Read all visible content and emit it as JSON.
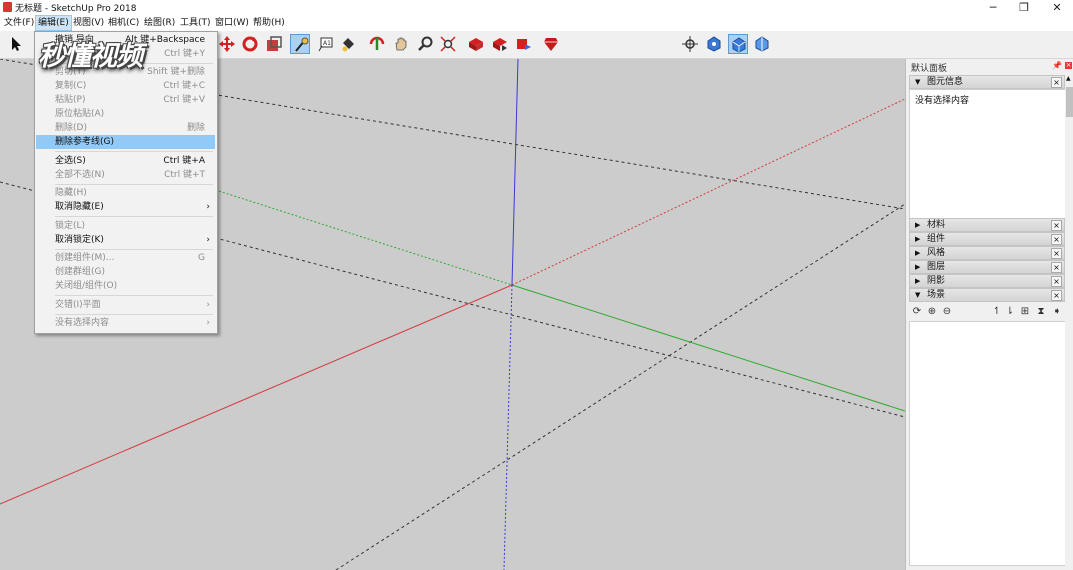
{
  "window": {
    "title": "无标题 - SketchUp Pro 2018",
    "controls": [
      "minimize-icon",
      "restore-icon",
      "close-icon"
    ]
  },
  "menubar": [
    "文件(F)",
    "编辑(E)",
    "视图(V)",
    "相机(C)",
    "绘图(R)",
    "工具(T)",
    "窗口(W)",
    "帮助(H)"
  ],
  "watermark": "秒懂视频",
  "edit_menu": [
    {
      "label": "撤销 导向",
      "shortcut": "Alt 键+Backspace",
      "disabled": false
    },
    {
      "label": "重复",
      "shortcut": "Ctrl 键+Y",
      "disabled": true
    },
    {
      "label": "剪切(T)",
      "shortcut": "Shift 键+删除",
      "disabled": true
    },
    {
      "label": "复制(C)",
      "shortcut": "Ctrl 键+C",
      "disabled": true
    },
    {
      "label": "粘贴(P)",
      "shortcut": "Ctrl 键+V",
      "disabled": true
    },
    {
      "label": "原位粘贴(A)",
      "shortcut": "",
      "disabled": true
    },
    {
      "label": "删除(D)",
      "shortcut": "删除",
      "disabled": true
    },
    {
      "label": "删除参考线(G)",
      "shortcut": "",
      "disabled": false,
      "highlighted": true
    },
    {
      "label": "全选(S)",
      "shortcut": "Ctrl 键+A",
      "disabled": false
    },
    {
      "label": "全部不选(N)",
      "shortcut": "Ctrl 键+T",
      "disabled": true
    },
    {
      "label": "隐藏(H)",
      "shortcut": "",
      "disabled": true
    },
    {
      "label": "取消隐藏(E)",
      "shortcut": "",
      "disabled": false,
      "submenu": true
    },
    {
      "label": "锁定(L)",
      "shortcut": "",
      "disabled": true
    },
    {
      "label": "取消锁定(K)",
      "shortcut": "",
      "disabled": false,
      "submenu": true
    },
    {
      "label": "创建组件(M)...",
      "shortcut": "G",
      "disabled": true
    },
    {
      "label": "创建群组(G)",
      "shortcut": "",
      "disabled": true
    },
    {
      "label": "关闭组/组件(O)",
      "shortcut": "",
      "disabled": true
    },
    {
      "label": "交错(I)平面",
      "shortcut": "",
      "disabled": true,
      "submenu": true
    },
    {
      "label": "没有选择内容",
      "shortcut": "",
      "disabled": true,
      "submenu": true
    }
  ],
  "panel": {
    "title": "默认面板",
    "entity_info": {
      "header": "图元信息",
      "body": "没有选择内容"
    },
    "collapsed": [
      "材料",
      "组件",
      "风格",
      "图层",
      "阴影"
    ],
    "scenes": {
      "header": "场景"
    },
    "close_glyph": "×",
    "expanded_glyph": "▼",
    "collapsed_glyph": "▶"
  },
  "colors": {
    "axis_red": "#d43a3a",
    "axis_green": "#2fa92f",
    "axis_blue": "#3a3ad4",
    "viewport_bg": "#cccccc",
    "highlight": "#91c9f7"
  }
}
